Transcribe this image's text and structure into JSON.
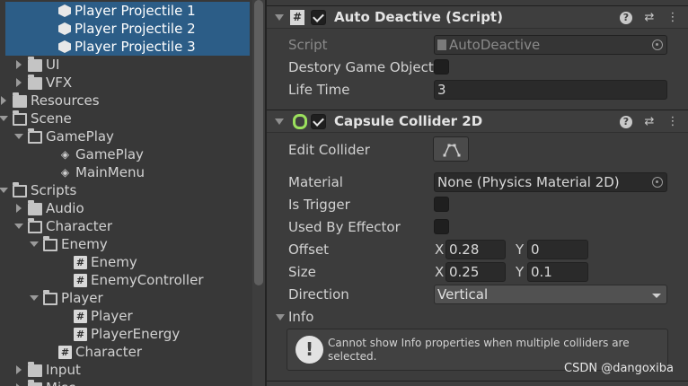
{
  "tree": {
    "rows": [
      {
        "label": "Player Projectile 1",
        "icon": "prefab-cube-icon",
        "depth": 4,
        "arrow": "none",
        "selected": true
      },
      {
        "label": "Player Projectile 2",
        "icon": "prefab-cube-icon",
        "depth": 4,
        "arrow": "none",
        "selected": true
      },
      {
        "label": "Player Projectile 3",
        "icon": "prefab-cube-icon",
        "depth": 4,
        "arrow": "none",
        "selected": true
      },
      {
        "label": "UI",
        "icon": "folder-icon",
        "depth": 2,
        "arrow": "right",
        "selected": false
      },
      {
        "label": "VFX",
        "icon": "folder-icon",
        "depth": 2,
        "arrow": "right",
        "selected": false
      },
      {
        "label": "Resources",
        "icon": "folder-icon",
        "depth": 1,
        "arrow": "right",
        "selected": false
      },
      {
        "label": "Scene",
        "icon": "folder-open-icon",
        "depth": 1,
        "arrow": "down",
        "selected": false
      },
      {
        "label": "GamePlay",
        "icon": "folder-open-icon",
        "depth": 2,
        "arrow": "down",
        "selected": false
      },
      {
        "label": "GamePlay",
        "icon": "unity-scene-icon",
        "depth": 4,
        "arrow": "none",
        "selected": false
      },
      {
        "label": "MainMenu",
        "icon": "unity-scene-icon",
        "depth": 4,
        "arrow": "none",
        "selected": false
      },
      {
        "label": "Scripts",
        "icon": "folder-open-icon",
        "depth": 1,
        "arrow": "down",
        "selected": false
      },
      {
        "label": "Audio",
        "icon": "folder-icon",
        "depth": 2,
        "arrow": "right",
        "selected": false
      },
      {
        "label": "Character",
        "icon": "folder-open-icon",
        "depth": 2,
        "arrow": "down",
        "selected": false
      },
      {
        "label": "Enemy",
        "icon": "folder-open-icon",
        "depth": 3,
        "arrow": "down",
        "selected": false
      },
      {
        "label": "Enemy",
        "icon": "csharp-script-icon",
        "depth": 5,
        "arrow": "none",
        "selected": false
      },
      {
        "label": "EnemyController",
        "icon": "csharp-script-icon",
        "depth": 5,
        "arrow": "none",
        "selected": false
      },
      {
        "label": "Player",
        "icon": "folder-open-icon",
        "depth": 3,
        "arrow": "down",
        "selected": false
      },
      {
        "label": "Player",
        "icon": "csharp-script-icon",
        "depth": 5,
        "arrow": "none",
        "selected": false
      },
      {
        "label": "PlayerEnergy",
        "icon": "csharp-script-icon",
        "depth": 5,
        "arrow": "none",
        "selected": false
      },
      {
        "label": "Character",
        "icon": "csharp-script-icon",
        "depth": 4,
        "arrow": "none",
        "selected": false
      },
      {
        "label": "Input",
        "icon": "folder-icon",
        "depth": 2,
        "arrow": "right",
        "selected": false
      },
      {
        "label": "Misc",
        "icon": "folder-icon",
        "depth": 2,
        "arrow": "right",
        "selected": false
      }
    ]
  },
  "auto_deactive": {
    "title": "Auto Deactive (Script)",
    "enabled": true,
    "script_label": "Script",
    "script_value": "AutoDeactive",
    "destroy_label": "Destory Game Object",
    "destroy_checked": false,
    "lifetime_label": "Life Time",
    "lifetime_value": "3"
  },
  "capsule_collider": {
    "title": "Capsule Collider 2D",
    "enabled": true,
    "edit_collider_label": "Edit Collider",
    "material_label": "Material",
    "material_value": "None (Physics Material 2D)",
    "is_trigger_label": "Is Trigger",
    "is_trigger_checked": false,
    "used_by_effector_label": "Used By Effector",
    "used_by_effector_checked": false,
    "offset_label": "Offset",
    "offset_x_label": "X",
    "offset_x": "0.28",
    "offset_y_label": "Y",
    "offset_y": "0",
    "size_label": "Size",
    "size_x_label": "X",
    "size_x": "0.25",
    "size_y_label": "Y",
    "size_y": "0.1",
    "direction_label": "Direction",
    "direction_value": "Vertical",
    "info_label": "Info",
    "info_message": "Cannot show Info properties when multiple colliders are selected."
  },
  "header_icons": {
    "help": "?",
    "presets": "⇄",
    "menu": "⋮"
  },
  "watermark": "CSDN @dangoxiba",
  "colors": {
    "selection": "#2c5d87",
    "panel": "#3c3c3c",
    "capsule_icon": "#9be05d"
  }
}
